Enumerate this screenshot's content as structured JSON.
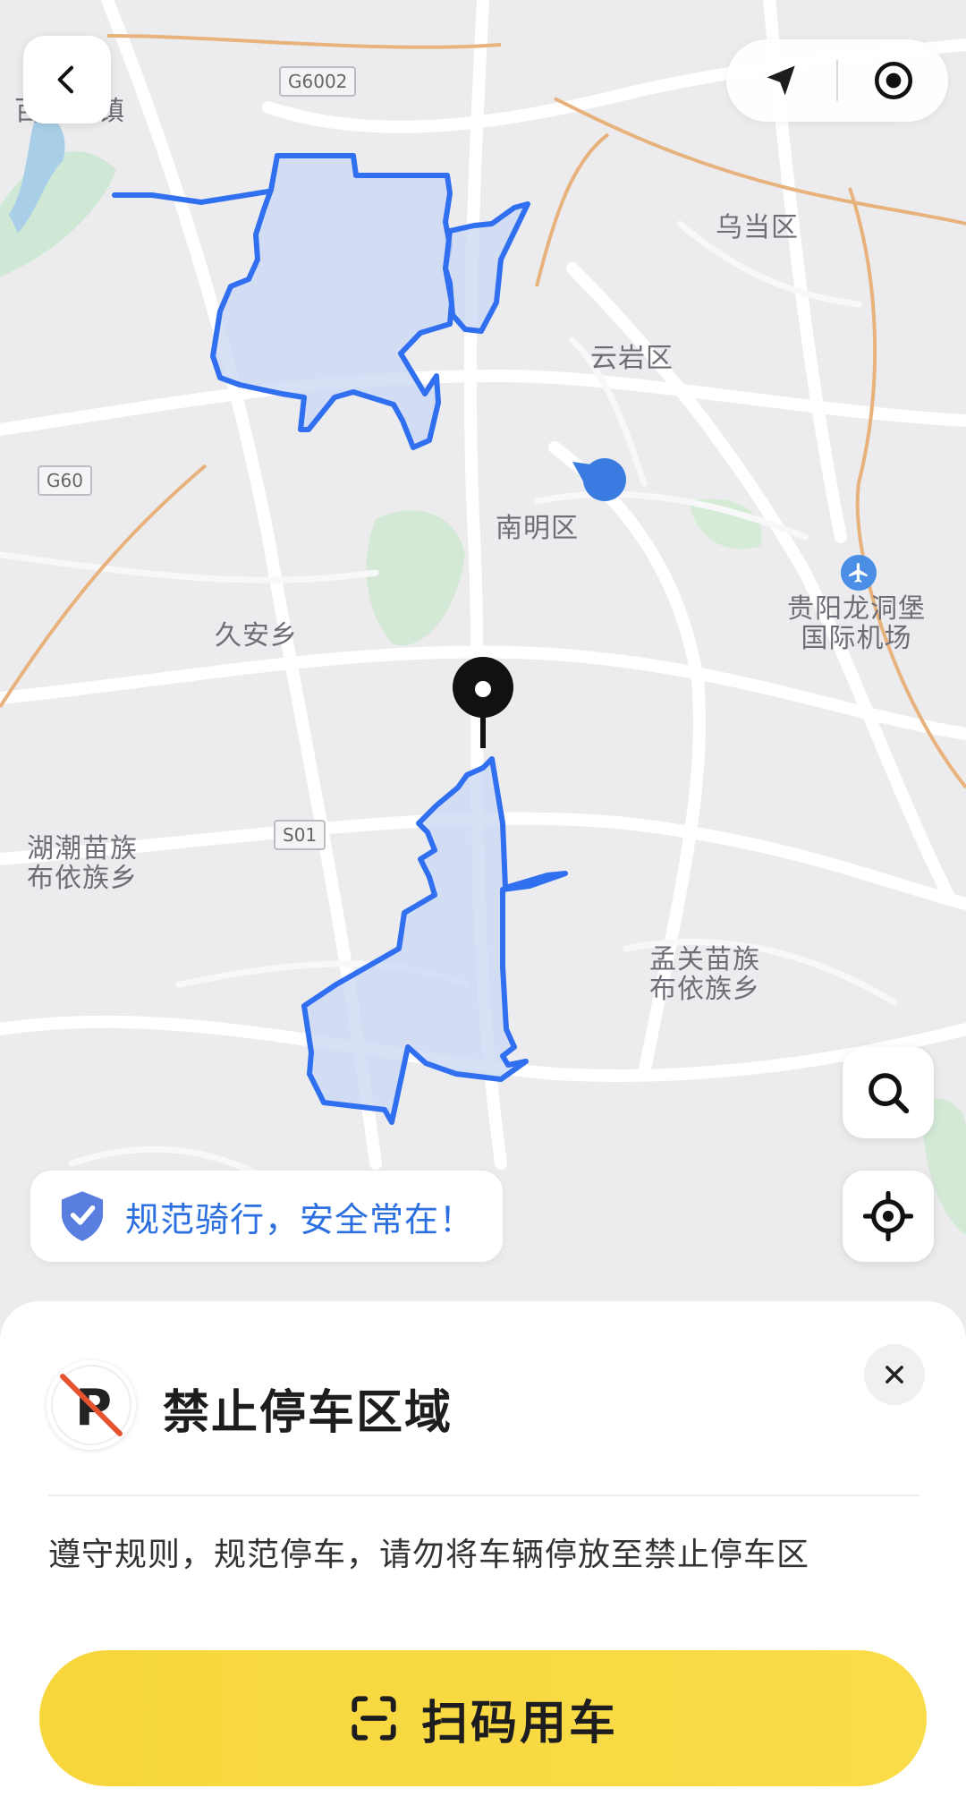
{
  "map": {
    "road_shields": {
      "g6002": "G6002",
      "g60": "G60",
      "s01": "S01"
    },
    "places": {
      "baihua_town": "百花湖镇",
      "wudang": "乌当区",
      "yunyan": "云岩区",
      "nanming": "南明区",
      "jiuan": "久安乡",
      "airport": "贵阳龙洞堡\n国际机场",
      "huchao": "湖潮苗族\n布依族乡",
      "mengguan": "孟关苗族\n布依族乡"
    },
    "zone_color": "#2f6ff0",
    "zone_fill": "#c7d6f4"
  },
  "notice": {
    "text": "规范骑行，安全常在！"
  },
  "panel": {
    "title": "禁止停车区域",
    "description": "遵守规则，规范停车，请勿将车辆停放至禁止停车区",
    "scan_label": "扫码用车"
  },
  "colors": {
    "accent_yellow": "#f8d940",
    "blue": "#2f6ff0",
    "no_park_red": "#e5542f"
  }
}
